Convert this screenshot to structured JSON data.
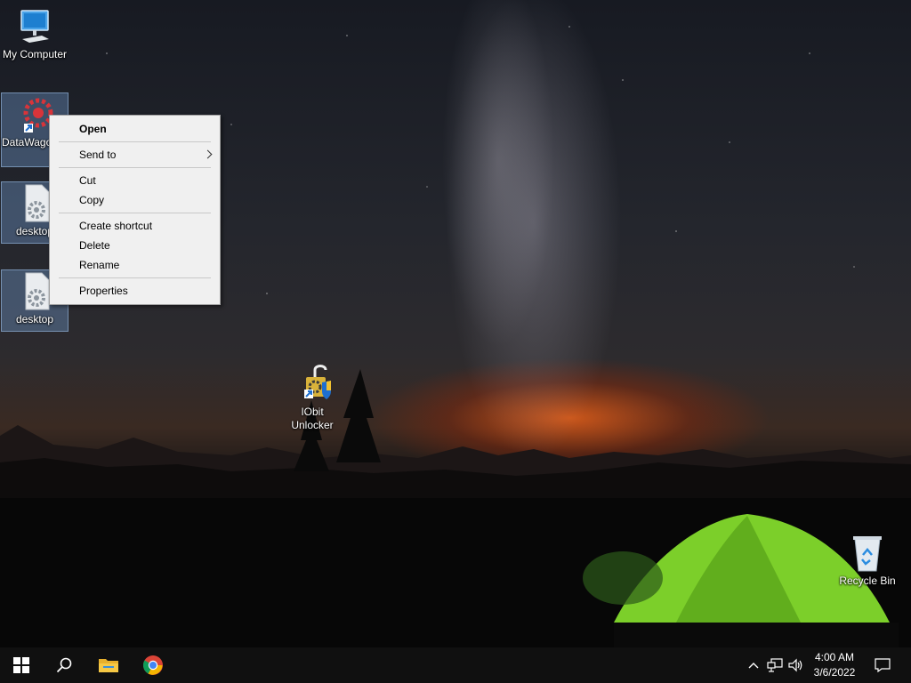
{
  "desktop": {
    "icons": {
      "my_computer": "My Computer",
      "datawagon": "DataWagon.com",
      "desktop_file_1": "desktop",
      "desktop_file_2": "desktop",
      "iobit_unlocker": "IObit Unlocker",
      "recycle_bin": "Recycle Bin"
    }
  },
  "context_menu": {
    "open": "Open",
    "send_to": "Send to",
    "cut": "Cut",
    "copy": "Copy",
    "create_shortcut": "Create shortcut",
    "delete": "Delete",
    "rename": "Rename",
    "properties": "Properties"
  },
  "taskbar": {
    "start_icon": "windows-start-icon",
    "search_icon": "search-icon",
    "file_explorer_icon": "folder-icon",
    "chrome_icon": "chrome-icon",
    "tray": {
      "chevron_icon": "chevron-up-icon",
      "network_icon": "network-icon",
      "volume_icon": "speaker-icon",
      "notification_icon": "notification-icon"
    },
    "clock": {
      "time": "4:00 AM",
      "date": "3/6/2022"
    }
  },
  "colors": {
    "taskbar": "#101010",
    "menu_background": "#f0f0f0",
    "selection": "#6e96c8",
    "tent": "#7ccf2a",
    "horizon_glow": "#e65f19"
  }
}
